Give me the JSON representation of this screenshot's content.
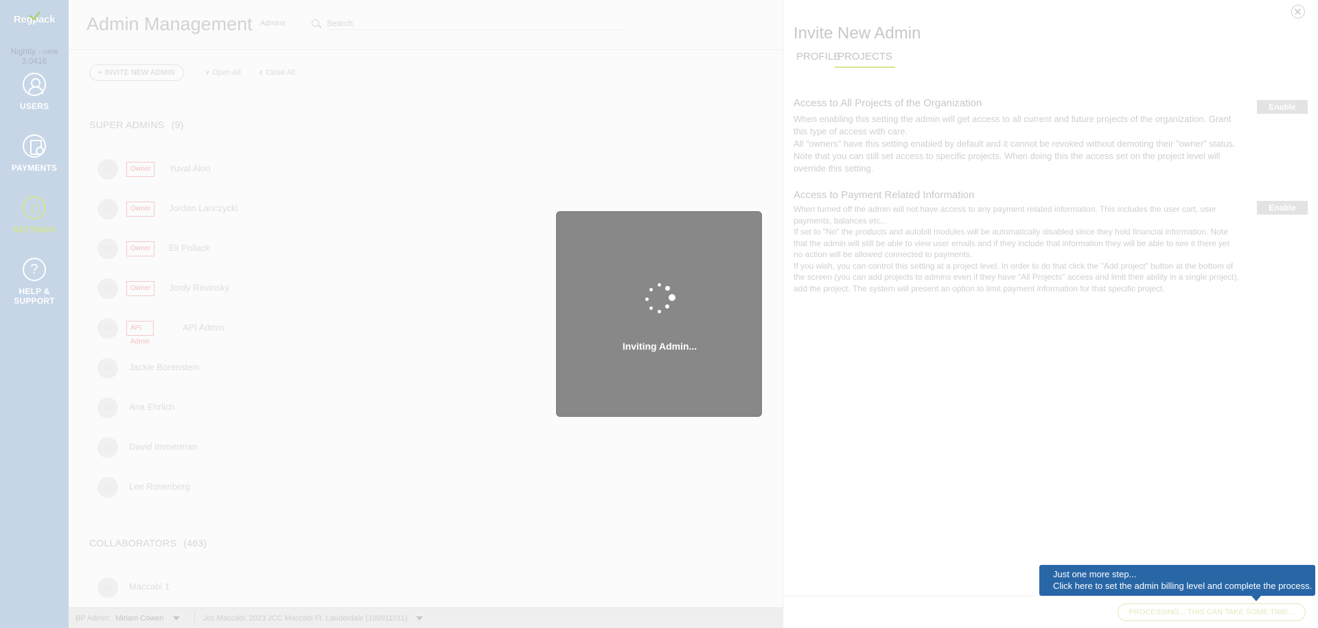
{
  "sidebar": {
    "logo": "Regpack",
    "version_line1": "Nightly - new",
    "version_line2": "3.0416",
    "items": [
      {
        "label": "USERS",
        "icon": "users-icon"
      },
      {
        "label": "PAYMENTS",
        "icon": "payments-icon"
      },
      {
        "label": "SETTINGS",
        "icon": "settings-icon",
        "active": true
      },
      {
        "label_line1": "HELP &",
        "label_line2": "SUPPORT",
        "icon": "help-icon"
      }
    ],
    "help_glyph": "?"
  },
  "main": {
    "title": "Admin Management",
    "dropdown_label": "Admins",
    "search_placeholder": "Search",
    "invite_button": "+ INVITE NEW ADMIN",
    "open_all": "∨ Open All",
    "close_all": "∧ Close All",
    "super_admins_title": "SUPER ADMINS",
    "super_admins_count": "(9)",
    "super_admins": [
      {
        "initials": "YA",
        "badge": "Owner",
        "name": "Yuval Alon"
      },
      {
        "initials": "JL",
        "badge": "Owner",
        "name": "Jordan Lanczycki"
      },
      {
        "initials": "EP",
        "badge": "Owner",
        "name": "Eli Pollack"
      },
      {
        "initials": "JR",
        "badge": "Owner",
        "name": "Jordy Rovinsky"
      },
      {
        "initials": "AA",
        "badge": "API Admin",
        "name": "API Admin"
      },
      {
        "initials": "JB",
        "badge": "",
        "name": "Jackie Borenstein"
      },
      {
        "initials": "AE",
        "badge": "",
        "name": "Ana Ehrlich"
      },
      {
        "initials": "DI",
        "badge": "",
        "name": "David Immerman"
      },
      {
        "initials": "LR",
        "badge": "",
        "name": "Lee Rosenberg"
      }
    ],
    "collaborators_title": "COLLABORATORS",
    "collaborators_count": "(463)",
    "collaborators": [
      {
        "initials": "M1",
        "name": "Maccabi 1"
      }
    ]
  },
  "bottom_bar": {
    "admin_prefix": "BP Admin:",
    "admin_name": "Miriam Cowen",
    "project": "Jcc Maccabi: 2023 JCC Maccabi Ft. Lauderdale (100911011)"
  },
  "panel": {
    "title": "Invite New Admin",
    "tabs": [
      "PROFILE",
      "PROJECTS"
    ],
    "active_tab": "PROJECTS",
    "settings": [
      {
        "title": "Access to All Projects of the Organization",
        "button": "Enable",
        "paragraphs": [
          "When enabling this setting the admin will get access to all current and future projects of the organization. Grant this type of access with care.",
          "All \"owners\" have this setting enabled by default and it cannot be revoked without demoting their \"owner\" status. Note that you can still set access to specific projects. When doing this the access set on the project level will override this setting."
        ]
      },
      {
        "title": "Access to Payment Related Information",
        "button": "Enable",
        "paragraphs": [
          "When turned off the admin will not have access to any payment related information. This includes the user cart, user payments, balances etc...",
          "If set to \"No\" the products and autobill modules will be automatically disabled since they hold financial information. Note that the admin will still be able to view user emails and if they include that information they will be able to see it there yet no action will be allowed connected to payments.",
          "If you wish, you can control this setting at a project level. In order to do that click the \"Add project\" button at the bottom of the screen (you can add projects to admins even if they have \"All Projects\" access and limit their ability in a single project), add the project. The system will present an option to limit payment information for that specific project."
        ]
      }
    ],
    "processing_button": "PROCESSING... THIS CAN TAKE SOME TIME..."
  },
  "tooltip": {
    "line1": "Just one more step...",
    "line2": "Click here to set the admin billing level and complete the process."
  },
  "loader": {
    "text": "Inviting Admin..."
  },
  "colors": {
    "sidebar_bg": "#c7d6e7",
    "active_accent": "#d5e58e",
    "tooltip_bg": "#2866a6",
    "loader_bg": "#888888",
    "owner_badge": "#f3c9c9"
  }
}
